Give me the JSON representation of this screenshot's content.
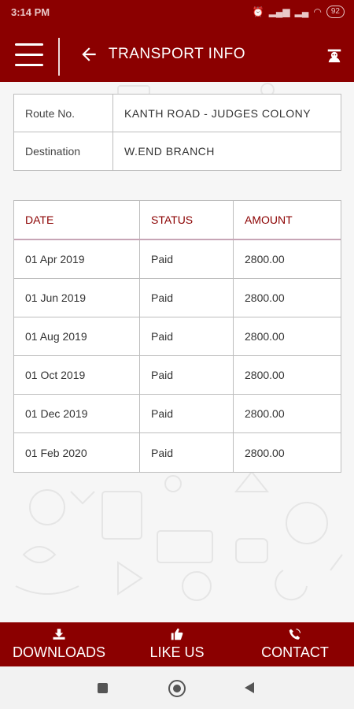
{
  "status_bar": {
    "time": "3:14 PM",
    "battery": "92"
  },
  "app_bar": {
    "title": "TRANSPORT INFO"
  },
  "route_info": {
    "rows": [
      {
        "label": "Route No.",
        "value": "KANTH ROAD - JUDGES COLONY"
      },
      {
        "label": "Destination",
        "value": "W.END BRANCH"
      }
    ]
  },
  "fees": {
    "headers": {
      "date": "DATE",
      "status": "STATUS",
      "amount": "AMOUNT"
    },
    "rows": [
      {
        "date": "01 Apr 2019",
        "status": "Paid",
        "amount": "2800.00"
      },
      {
        "date": "01 Jun 2019",
        "status": "Paid",
        "amount": "2800.00"
      },
      {
        "date": "01 Aug 2019",
        "status": "Paid",
        "amount": "2800.00"
      },
      {
        "date": "01 Oct 2019",
        "status": "Paid",
        "amount": "2800.00"
      },
      {
        "date": "01 Dec 2019",
        "status": "Paid",
        "amount": "2800.00"
      },
      {
        "date": "01 Feb 2020",
        "status": "Paid",
        "amount": "2800.00"
      }
    ]
  },
  "bottom_nav": {
    "downloads": "DOWNLOADS",
    "like_us": "LIKE US",
    "contact": "CONTACT"
  },
  "colors": {
    "brand": "#8b0000",
    "header_text": "#8b0000"
  }
}
